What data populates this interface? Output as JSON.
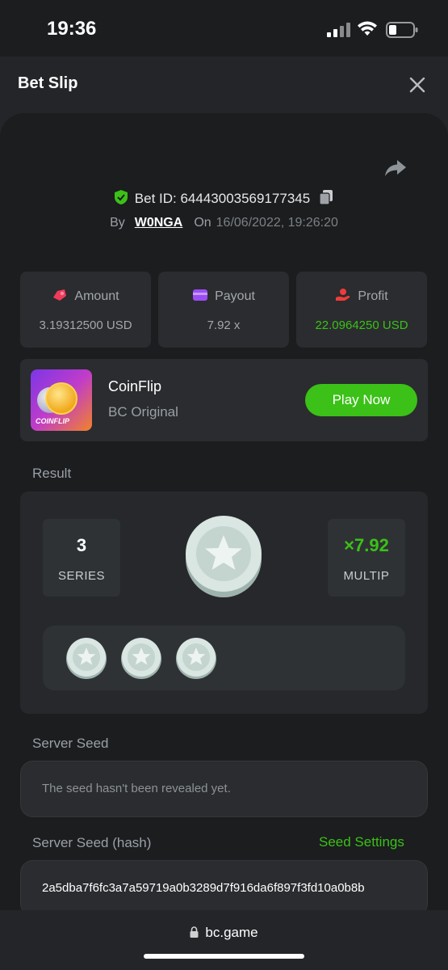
{
  "status_bar": {
    "time": "19:36"
  },
  "header": {
    "title": "Bet Slip"
  },
  "bet": {
    "bet_id_label": "Bet ID: 64443003569177345",
    "by_label": "By",
    "user": "W0NGA",
    "on_label": "On",
    "datetime": "16/06/2022, 19:26:20"
  },
  "stats": [
    {
      "label": "Amount",
      "value": "3.19312500 USD",
      "icon": "money-bag-icon"
    },
    {
      "label": "Payout",
      "value": "7.92 x",
      "icon": "wallet-icon"
    },
    {
      "label": "Profit",
      "value": "22.0964250 USD",
      "icon": "hand-coin-icon"
    }
  ],
  "game": {
    "thumb_text": "COINFLIP",
    "name": "CoinFlip",
    "provider": "BC Original",
    "play_label": "Play Now"
  },
  "result": {
    "section_label": "Result",
    "series_value": "3",
    "series_label": "SERIES",
    "multiplier_value": "×7.92",
    "multiplier_label": "MULTIP",
    "history_count": 3
  },
  "server_seed": {
    "label": "Server Seed",
    "value": "The seed hasn't been revealed yet."
  },
  "server_seed_hash": {
    "label": "Server Seed (hash)",
    "settings_label": "Seed Settings",
    "value": "2a5dba7f6fc3a7a59719a0b3289d7f916da6f897f3fd10a0b8b"
  },
  "browser": {
    "url": "bc.game"
  },
  "colors": {
    "accent_green": "#3bc117",
    "background": "#1b1d1f",
    "card": "#2a2c2f"
  }
}
